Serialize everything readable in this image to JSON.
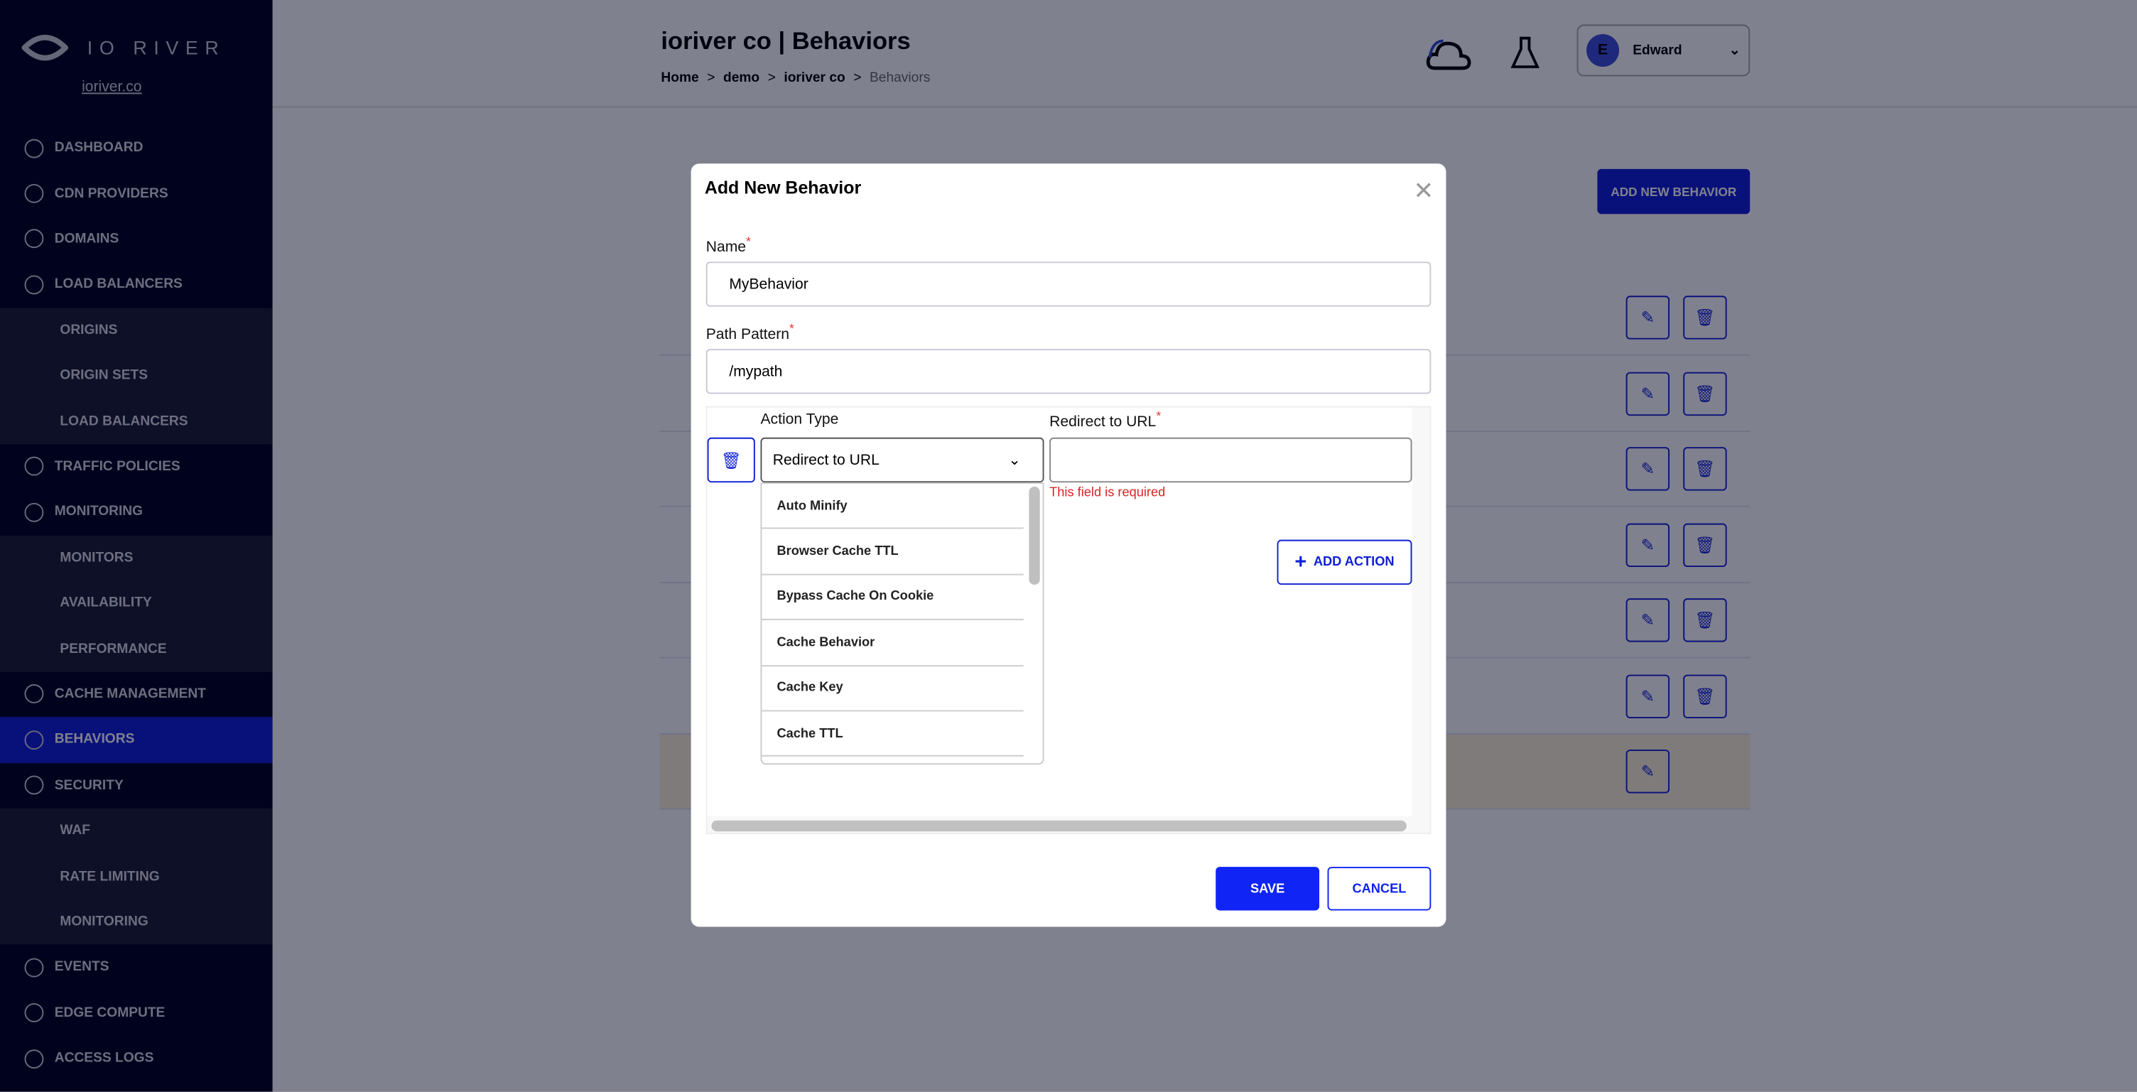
{
  "sidebar": {
    "brand": "IO RIVER",
    "org": "ioriver.co",
    "items": [
      {
        "label": "DASHBOARD",
        "type": "main"
      },
      {
        "label": "CDN PROVIDERS",
        "type": "main"
      },
      {
        "label": "DOMAINS",
        "type": "main"
      },
      {
        "label": "LOAD BALANCERS",
        "type": "main"
      },
      {
        "label": "ORIGINS",
        "type": "sub"
      },
      {
        "label": "ORIGIN SETS",
        "type": "sub"
      },
      {
        "label": "LOAD BALANCERS",
        "type": "sub"
      },
      {
        "label": "TRAFFIC POLICIES",
        "type": "main"
      },
      {
        "label": "MONITORING",
        "type": "main"
      },
      {
        "label": "MONITORS",
        "type": "sub"
      },
      {
        "label": "AVAILABILITY",
        "type": "sub"
      },
      {
        "label": "PERFORMANCE",
        "type": "sub"
      },
      {
        "label": "CACHE MANAGEMENT",
        "type": "main"
      },
      {
        "label": "BEHAVIORS",
        "type": "active"
      },
      {
        "label": "SECURITY",
        "type": "main"
      },
      {
        "label": "WAF",
        "type": "sub"
      },
      {
        "label": "RATE LIMITING",
        "type": "sub"
      },
      {
        "label": "MONITORING",
        "type": "sub"
      },
      {
        "label": "EVENTS",
        "type": "main"
      },
      {
        "label": "EDGE COMPUTE",
        "type": "main"
      },
      {
        "label": "ACCESS LOGS",
        "type": "main"
      }
    ]
  },
  "header": {
    "title": "ioriver co | Behaviors",
    "breadcrumb": [
      "Home",
      ">",
      "demo",
      ">",
      "ioriver co",
      ">",
      "Behaviors"
    ],
    "user": {
      "initial": "E",
      "name": "Edward"
    },
    "add_button": "ADD NEW BEHAVIOR"
  },
  "modal": {
    "title": "Add New Behavior",
    "name_label": "Name",
    "name_value": "MyBehavior",
    "path_label": "Path Pattern",
    "path_value": "/mypath",
    "required_mark": "*",
    "action_type_label": "Action Type",
    "action_type_value": "Redirect to URL",
    "redirect_label": "Redirect to URL",
    "redirect_value": "",
    "error": "This field is required",
    "options": [
      "Auto Minify",
      "Browser Cache TTL",
      "Bypass Cache On Cookie",
      "Cache Behavior",
      "Cache Key",
      "Cache TTL"
    ],
    "add_action": "ADD ACTION",
    "save": "SAVE",
    "cancel": "CANCEL"
  },
  "colors": {
    "accent": "#0f24f5",
    "sidebar": "#01021e",
    "error": "#dd2222"
  }
}
